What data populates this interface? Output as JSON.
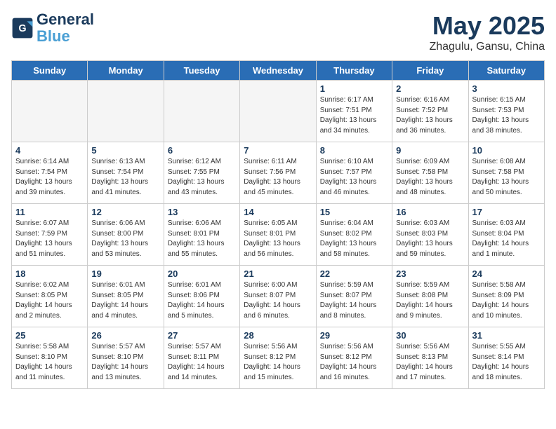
{
  "header": {
    "logo_line1": "General",
    "logo_line2": "Blue",
    "month": "May 2025",
    "location": "Zhagulu, Gansu, China"
  },
  "days_of_week": [
    "Sunday",
    "Monday",
    "Tuesday",
    "Wednesday",
    "Thursday",
    "Friday",
    "Saturday"
  ],
  "weeks": [
    [
      {
        "day": "",
        "empty": true
      },
      {
        "day": "",
        "empty": true
      },
      {
        "day": "",
        "empty": true
      },
      {
        "day": "",
        "empty": true
      },
      {
        "day": "1",
        "sunrise": "6:17 AM",
        "sunset": "7:51 PM",
        "daylight": "13 hours and 34 minutes."
      },
      {
        "day": "2",
        "sunrise": "6:16 AM",
        "sunset": "7:52 PM",
        "daylight": "13 hours and 36 minutes."
      },
      {
        "day": "3",
        "sunrise": "6:15 AM",
        "sunset": "7:53 PM",
        "daylight": "13 hours and 38 minutes."
      }
    ],
    [
      {
        "day": "4",
        "sunrise": "6:14 AM",
        "sunset": "7:54 PM",
        "daylight": "13 hours and 39 minutes."
      },
      {
        "day": "5",
        "sunrise": "6:13 AM",
        "sunset": "7:54 PM",
        "daylight": "13 hours and 41 minutes."
      },
      {
        "day": "6",
        "sunrise": "6:12 AM",
        "sunset": "7:55 PM",
        "daylight": "13 hours and 43 minutes."
      },
      {
        "day": "7",
        "sunrise": "6:11 AM",
        "sunset": "7:56 PM",
        "daylight": "13 hours and 45 minutes."
      },
      {
        "day": "8",
        "sunrise": "6:10 AM",
        "sunset": "7:57 PM",
        "daylight": "13 hours and 46 minutes."
      },
      {
        "day": "9",
        "sunrise": "6:09 AM",
        "sunset": "7:58 PM",
        "daylight": "13 hours and 48 minutes."
      },
      {
        "day": "10",
        "sunrise": "6:08 AM",
        "sunset": "7:58 PM",
        "daylight": "13 hours and 50 minutes."
      }
    ],
    [
      {
        "day": "11",
        "sunrise": "6:07 AM",
        "sunset": "7:59 PM",
        "daylight": "13 hours and 51 minutes."
      },
      {
        "day": "12",
        "sunrise": "6:06 AM",
        "sunset": "8:00 PM",
        "daylight": "13 hours and 53 minutes."
      },
      {
        "day": "13",
        "sunrise": "6:06 AM",
        "sunset": "8:01 PM",
        "daylight": "13 hours and 55 minutes."
      },
      {
        "day": "14",
        "sunrise": "6:05 AM",
        "sunset": "8:01 PM",
        "daylight": "13 hours and 56 minutes."
      },
      {
        "day": "15",
        "sunrise": "6:04 AM",
        "sunset": "8:02 PM",
        "daylight": "13 hours and 58 minutes."
      },
      {
        "day": "16",
        "sunrise": "6:03 AM",
        "sunset": "8:03 PM",
        "daylight": "13 hours and 59 minutes."
      },
      {
        "day": "17",
        "sunrise": "6:03 AM",
        "sunset": "8:04 PM",
        "daylight": "14 hours and 1 minute."
      }
    ],
    [
      {
        "day": "18",
        "sunrise": "6:02 AM",
        "sunset": "8:05 PM",
        "daylight": "14 hours and 2 minutes."
      },
      {
        "day": "19",
        "sunrise": "6:01 AM",
        "sunset": "8:05 PM",
        "daylight": "14 hours and 4 minutes."
      },
      {
        "day": "20",
        "sunrise": "6:01 AM",
        "sunset": "8:06 PM",
        "daylight": "14 hours and 5 minutes."
      },
      {
        "day": "21",
        "sunrise": "6:00 AM",
        "sunset": "8:07 PM",
        "daylight": "14 hours and 6 minutes."
      },
      {
        "day": "22",
        "sunrise": "5:59 AM",
        "sunset": "8:07 PM",
        "daylight": "14 hours and 8 minutes."
      },
      {
        "day": "23",
        "sunrise": "5:59 AM",
        "sunset": "8:08 PM",
        "daylight": "14 hours and 9 minutes."
      },
      {
        "day": "24",
        "sunrise": "5:58 AM",
        "sunset": "8:09 PM",
        "daylight": "14 hours and 10 minutes."
      }
    ],
    [
      {
        "day": "25",
        "sunrise": "5:58 AM",
        "sunset": "8:10 PM",
        "daylight": "14 hours and 11 minutes."
      },
      {
        "day": "26",
        "sunrise": "5:57 AM",
        "sunset": "8:10 PM",
        "daylight": "14 hours and 13 minutes."
      },
      {
        "day": "27",
        "sunrise": "5:57 AM",
        "sunset": "8:11 PM",
        "daylight": "14 hours and 14 minutes."
      },
      {
        "day": "28",
        "sunrise": "5:56 AM",
        "sunset": "8:12 PM",
        "daylight": "14 hours and 15 minutes."
      },
      {
        "day": "29",
        "sunrise": "5:56 AM",
        "sunset": "8:12 PM",
        "daylight": "14 hours and 16 minutes."
      },
      {
        "day": "30",
        "sunrise": "5:56 AM",
        "sunset": "8:13 PM",
        "daylight": "14 hours and 17 minutes."
      },
      {
        "day": "31",
        "sunrise": "5:55 AM",
        "sunset": "8:14 PM",
        "daylight": "14 hours and 18 minutes."
      }
    ]
  ]
}
